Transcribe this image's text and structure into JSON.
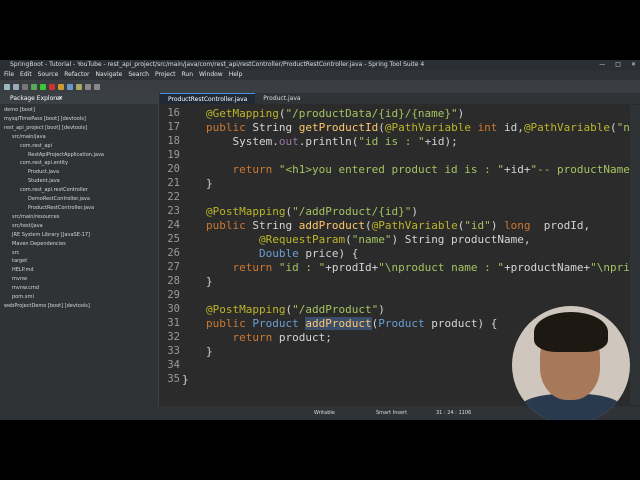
{
  "window": {
    "title": "SpringBoot - Tutorial - YouTube - rest_api_project/src/main/java/com/rest_api/restController/ProductRestController.java - Spring Tool Suite 4"
  },
  "menu": [
    "File",
    "Edit",
    "Source",
    "Refactor",
    "Navigate",
    "Search",
    "Project",
    "Run",
    "Window",
    "Help"
  ],
  "package_explorer": {
    "tab_label": "Package Explorer",
    "items": [
      "demo [boot]",
      "mysqlTimePass [boot] [devtools]",
      "rest_api_project [boot] [devtools]",
      "src/main/java",
      "com.rest_api",
      "RestApiProjectApplication.java",
      "com.rest_api.entity",
      "Product.java",
      "Student.java",
      "com.rest_api.restController",
      "DemoRestController.java",
      "ProductRestController.java",
      "src/main/resources",
      "src/test/java",
      "JRE System Library [JavaSE-17]",
      "Maven Dependencies",
      "src",
      "target",
      "HELP.md",
      "mvnw",
      "mvnw.cmd",
      "pom.xml",
      "webProjectDemo [boot] [devtools]"
    ]
  },
  "editor": {
    "tabs": [
      {
        "label": "ProductRestController.java",
        "active": true
      },
      {
        "label": "Product.java",
        "active": false
      }
    ],
    "line_numbers": [
      "16",
      "17",
      "18",
      "19",
      "20",
      "21",
      "22",
      "23",
      "24",
      "25",
      "26",
      "27",
      "28",
      "29",
      "30",
      "31",
      "32",
      "33",
      "34",
      "35"
    ]
  },
  "status": {
    "mode": "Writable",
    "insert": "Smart Insert",
    "position": "31 : 24 : 1106"
  },
  "colors": {
    "keyword": "#cc7832",
    "annotation": "#bbb529",
    "string": "#a5c261",
    "type": "#6a9fd4"
  }
}
